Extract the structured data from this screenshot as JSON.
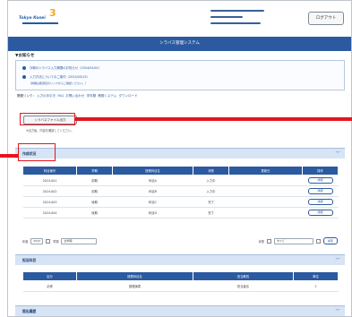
{
  "header": {
    "logo_text": "Tokyo Kosei",
    "logo_mark": "3",
    "logout_label": "ログアウト"
  },
  "title_bar": "シラバス管理システム",
  "notice": {
    "title": "▼お知らせ",
    "items": [
      "今期のシラバス入力期間のお知らせ（2024/04/01）",
      "入力方法についてのご案内（2024/03/15）"
    ],
    "sub": "（詳細は各項目のリンクからご確認ください。）"
  },
  "links": {
    "label": "関連リンク：",
    "items": [
      "入力の手引き",
      "FAQ",
      "お問い合わせ",
      "学年暦",
      "教務システム",
      "ダウンロード"
    ]
  },
  "action": {
    "button_label": "シラバスファイル出力",
    "note": "※出力後、内容を確認してください。"
  },
  "section1": {
    "title": "作成状況",
    "chevron": "﹀",
    "columns": [
      "科目番号",
      "学期",
      "授業科目名",
      "状態",
      "更新日",
      "操作"
    ],
    "rows": [
      [
        "2024-001",
        "前期",
        "科目A",
        "入力中",
        "",
        "詳細"
      ],
      [
        "2024-002",
        "前期",
        "科目B",
        "入力中",
        "",
        "詳細"
      ],
      [
        "2024-003",
        "後期",
        "科目C",
        "完了",
        "",
        "詳細"
      ],
      [
        "2024-004",
        "後期",
        "科目D",
        "完了",
        "",
        "詳細"
      ]
    ],
    "filter": {
      "year_label": "年度",
      "year_value": "2024",
      "term_label": "学期",
      "term_value": "全学期",
      "status_label": "状態",
      "status_value": "すべて",
      "go_label": "検索"
    }
  },
  "section2": {
    "title": "担当科目",
    "chevron": "﹀",
    "columns": [
      "区分",
      "授業科目名",
      "担当教員",
      "単位"
    ],
    "rows": [
      [
        "必修",
        "基礎演習",
        "担当者名",
        "2"
      ]
    ]
  },
  "section3": {
    "title": "提出履歴",
    "chevron": "﹀"
  },
  "colors": {
    "primary": "#2c5aa0",
    "section_bg": "#d6e4f5",
    "annotation_red": "#e8141b"
  }
}
